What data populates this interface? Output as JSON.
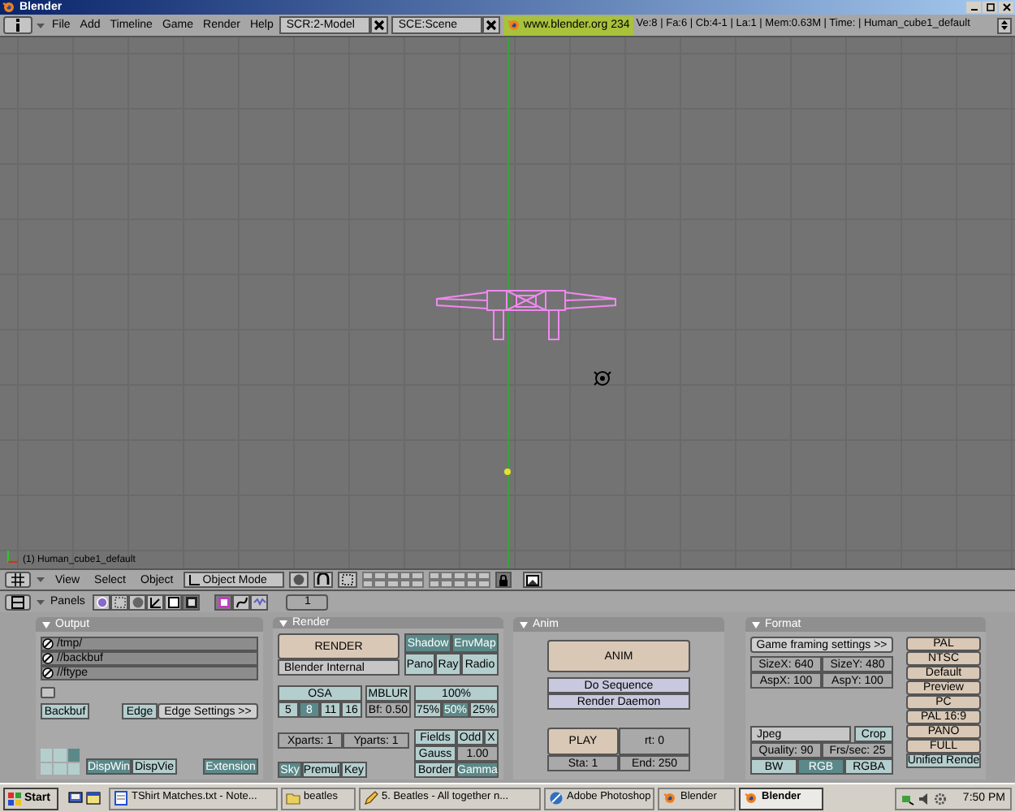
{
  "window": {
    "title": "Blender"
  },
  "header": {
    "menus": [
      "File",
      "Add",
      "Timeline",
      "Game",
      "Render",
      "Help"
    ],
    "screen": "SCR:2-Model",
    "scene": "SCE:Scene",
    "link": "www.blender.org 234",
    "stats": "Ve:8 | Fa:6 | Cb:4-1 | La:1 | Mem:0.63M | Time: | Human_cube1_default"
  },
  "viewport": {
    "object_label": "(1) Human_cube1_default"
  },
  "view3d_header": {
    "menus": [
      "View",
      "Select",
      "Object"
    ],
    "mode": "Object Mode"
  },
  "buttons_header": {
    "label": "Panels",
    "context_tabs": [
      {
        "selected": false
      },
      {
        "selected": false
      },
      {
        "selected": false
      },
      {
        "selected": false
      },
      {
        "selected": false
      },
      {
        "selected": true
      }
    ],
    "sub_tabs": [
      {
        "selected": true
      },
      {
        "selected": false
      },
      {
        "selected": false
      }
    ],
    "frame": "1"
  },
  "panels": [
    {
      "title": "Output",
      "paths": [
        "/tmp/",
        "//backbuf",
        "//ftype"
      ],
      "position_grid": [
        {
          "selected": false
        },
        {
          "selected": false
        },
        {
          "selected": true
        },
        {
          "selected": false
        },
        {
          "selected": false
        },
        {
          "selected": false
        }
      ],
      "buttons": [
        {
          "label": "Backbuf",
          "kind": "toggle",
          "on": false
        },
        {
          "label": "Edge",
          "kind": "toggle",
          "on": false
        },
        {
          "label": "Edge Settings >>",
          "kind": "plain"
        },
        {
          "label": "DispWin",
          "kind": "option",
          "selected": true
        },
        {
          "label": "DispVie",
          "kind": "option",
          "selected": false
        },
        {
          "label": "Extension",
          "kind": "toggle",
          "on": true
        }
      ]
    },
    {
      "title": "Render",
      "buttons": [
        {
          "label": "RENDER",
          "kind": "action"
        },
        {
          "label": "Blender Internal",
          "kind": "menu"
        },
        {
          "label": "Shadow",
          "kind": "toggle",
          "on": true
        },
        {
          "label": "EnvMap",
          "kind": "toggle",
          "on": true
        },
        {
          "label": "Pano",
          "kind": "toggle",
          "on": false
        },
        {
          "label": "Ray",
          "kind": "toggle",
          "on": false
        },
        {
          "label": "Radio",
          "kind": "toggle",
          "on": false
        },
        {
          "label": "OSA",
          "kind": "toggle",
          "on": false
        },
        {
          "label": "5",
          "kind": "option",
          "selected": false
        },
        {
          "label": "8",
          "kind": "option",
          "selected": true
        },
        {
          "label": "11",
          "kind": "option",
          "selected": false
        },
        {
          "label": "16",
          "kind": "option",
          "selected": false
        },
        {
          "label": "MBLUR",
          "kind": "toggle",
          "on": false
        },
        {
          "label": "Bf: 0.50",
          "kind": "num"
        },
        {
          "label": "100%",
          "kind": "option",
          "selected": false
        },
        {
          "label": "75%",
          "kind": "option",
          "selected": false
        },
        {
          "label": "50%",
          "kind": "option",
          "selected": true
        },
        {
          "label": "25%",
          "kind": "option",
          "selected": false
        },
        {
          "label": "Xparts: 1",
          "kind": "num"
        },
        {
          "label": "Yparts: 1",
          "kind": "num"
        },
        {
          "label": "Fields",
          "kind": "toggle",
          "on": false
        },
        {
          "label": "Odd",
          "kind": "toggle",
          "on": false
        },
        {
          "label": "X",
          "kind": "toggle",
          "on": false
        },
        {
          "label": "Gauss",
          "kind": "toggle",
          "on": false
        },
        {
          "label": "1.00",
          "kind": "num"
        },
        {
          "label": "Sky",
          "kind": "option",
          "selected": true
        },
        {
          "label": "Premul",
          "kind": "option",
          "selected": false
        },
        {
          "label": "Key",
          "kind": "option",
          "selected": false
        },
        {
          "label": "Border",
          "kind": "toggle",
          "on": false
        },
        {
          "label": "Gamma",
          "kind": "toggle",
          "on": true
        }
      ]
    },
    {
      "title": "Anim",
      "buttons": [
        {
          "label": "ANIM",
          "kind": "action"
        },
        {
          "label": "Do Sequence",
          "kind": "check",
          "on": false
        },
        {
          "label": "Render Daemon",
          "kind": "check",
          "on": false
        },
        {
          "label": "PLAY",
          "kind": "action"
        },
        {
          "label": "rt: 0",
          "kind": "num"
        },
        {
          "label": "Sta: 1",
          "kind": "num"
        },
        {
          "label": "End: 250",
          "kind": "num"
        }
      ]
    },
    {
      "title": "Format",
      "buttons": [
        {
          "label": "Game framing settings >>",
          "kind": "plain"
        },
        {
          "label": "SizeX: 640",
          "kind": "num"
        },
        {
          "label": "SizeY: 480",
          "kind": "num"
        },
        {
          "label": "AspX: 100",
          "kind": "num"
        },
        {
          "label": "AspY: 100",
          "kind": "num"
        },
        {
          "label": "Jpeg",
          "kind": "menu"
        },
        {
          "label": "Crop",
          "kind": "toggle",
          "on": false
        },
        {
          "label": "Quality: 90",
          "kind": "num"
        },
        {
          "label": "Frs/sec: 25",
          "kind": "num"
        },
        {
          "label": "BW",
          "kind": "option",
          "selected": false
        },
        {
          "label": "RGB",
          "kind": "option",
          "selected": true
        },
        {
          "label": "RGBA",
          "kind": "option",
          "selected": false
        },
        {
          "label": "PAL",
          "kind": "action"
        },
        {
          "label": "NTSC",
          "kind": "action"
        },
        {
          "label": "Default",
          "kind": "action"
        },
        {
          "label": "Preview",
          "kind": "action"
        },
        {
          "label": "PC",
          "kind": "action"
        },
        {
          "label": "PAL 16:9",
          "kind": "action"
        },
        {
          "label": "PANO",
          "kind": "action"
        },
        {
          "label": "FULL",
          "kind": "action"
        },
        {
          "label": "Unified Rende",
          "kind": "toggle",
          "on": false
        }
      ]
    }
  ],
  "taskbar": {
    "start": "Start",
    "tasks": [
      {
        "label": "TShirt Matches.txt - Note...",
        "selected": false
      },
      {
        "label": "beatles",
        "selected": false
      },
      {
        "label": "5. Beatles - All together n...",
        "selected": false
      },
      {
        "label": "Adobe Photoshop",
        "selected": false
      },
      {
        "label": "Blender",
        "selected": false
      },
      {
        "label": "Blender",
        "selected": true
      }
    ],
    "clock": "7:50 PM"
  }
}
